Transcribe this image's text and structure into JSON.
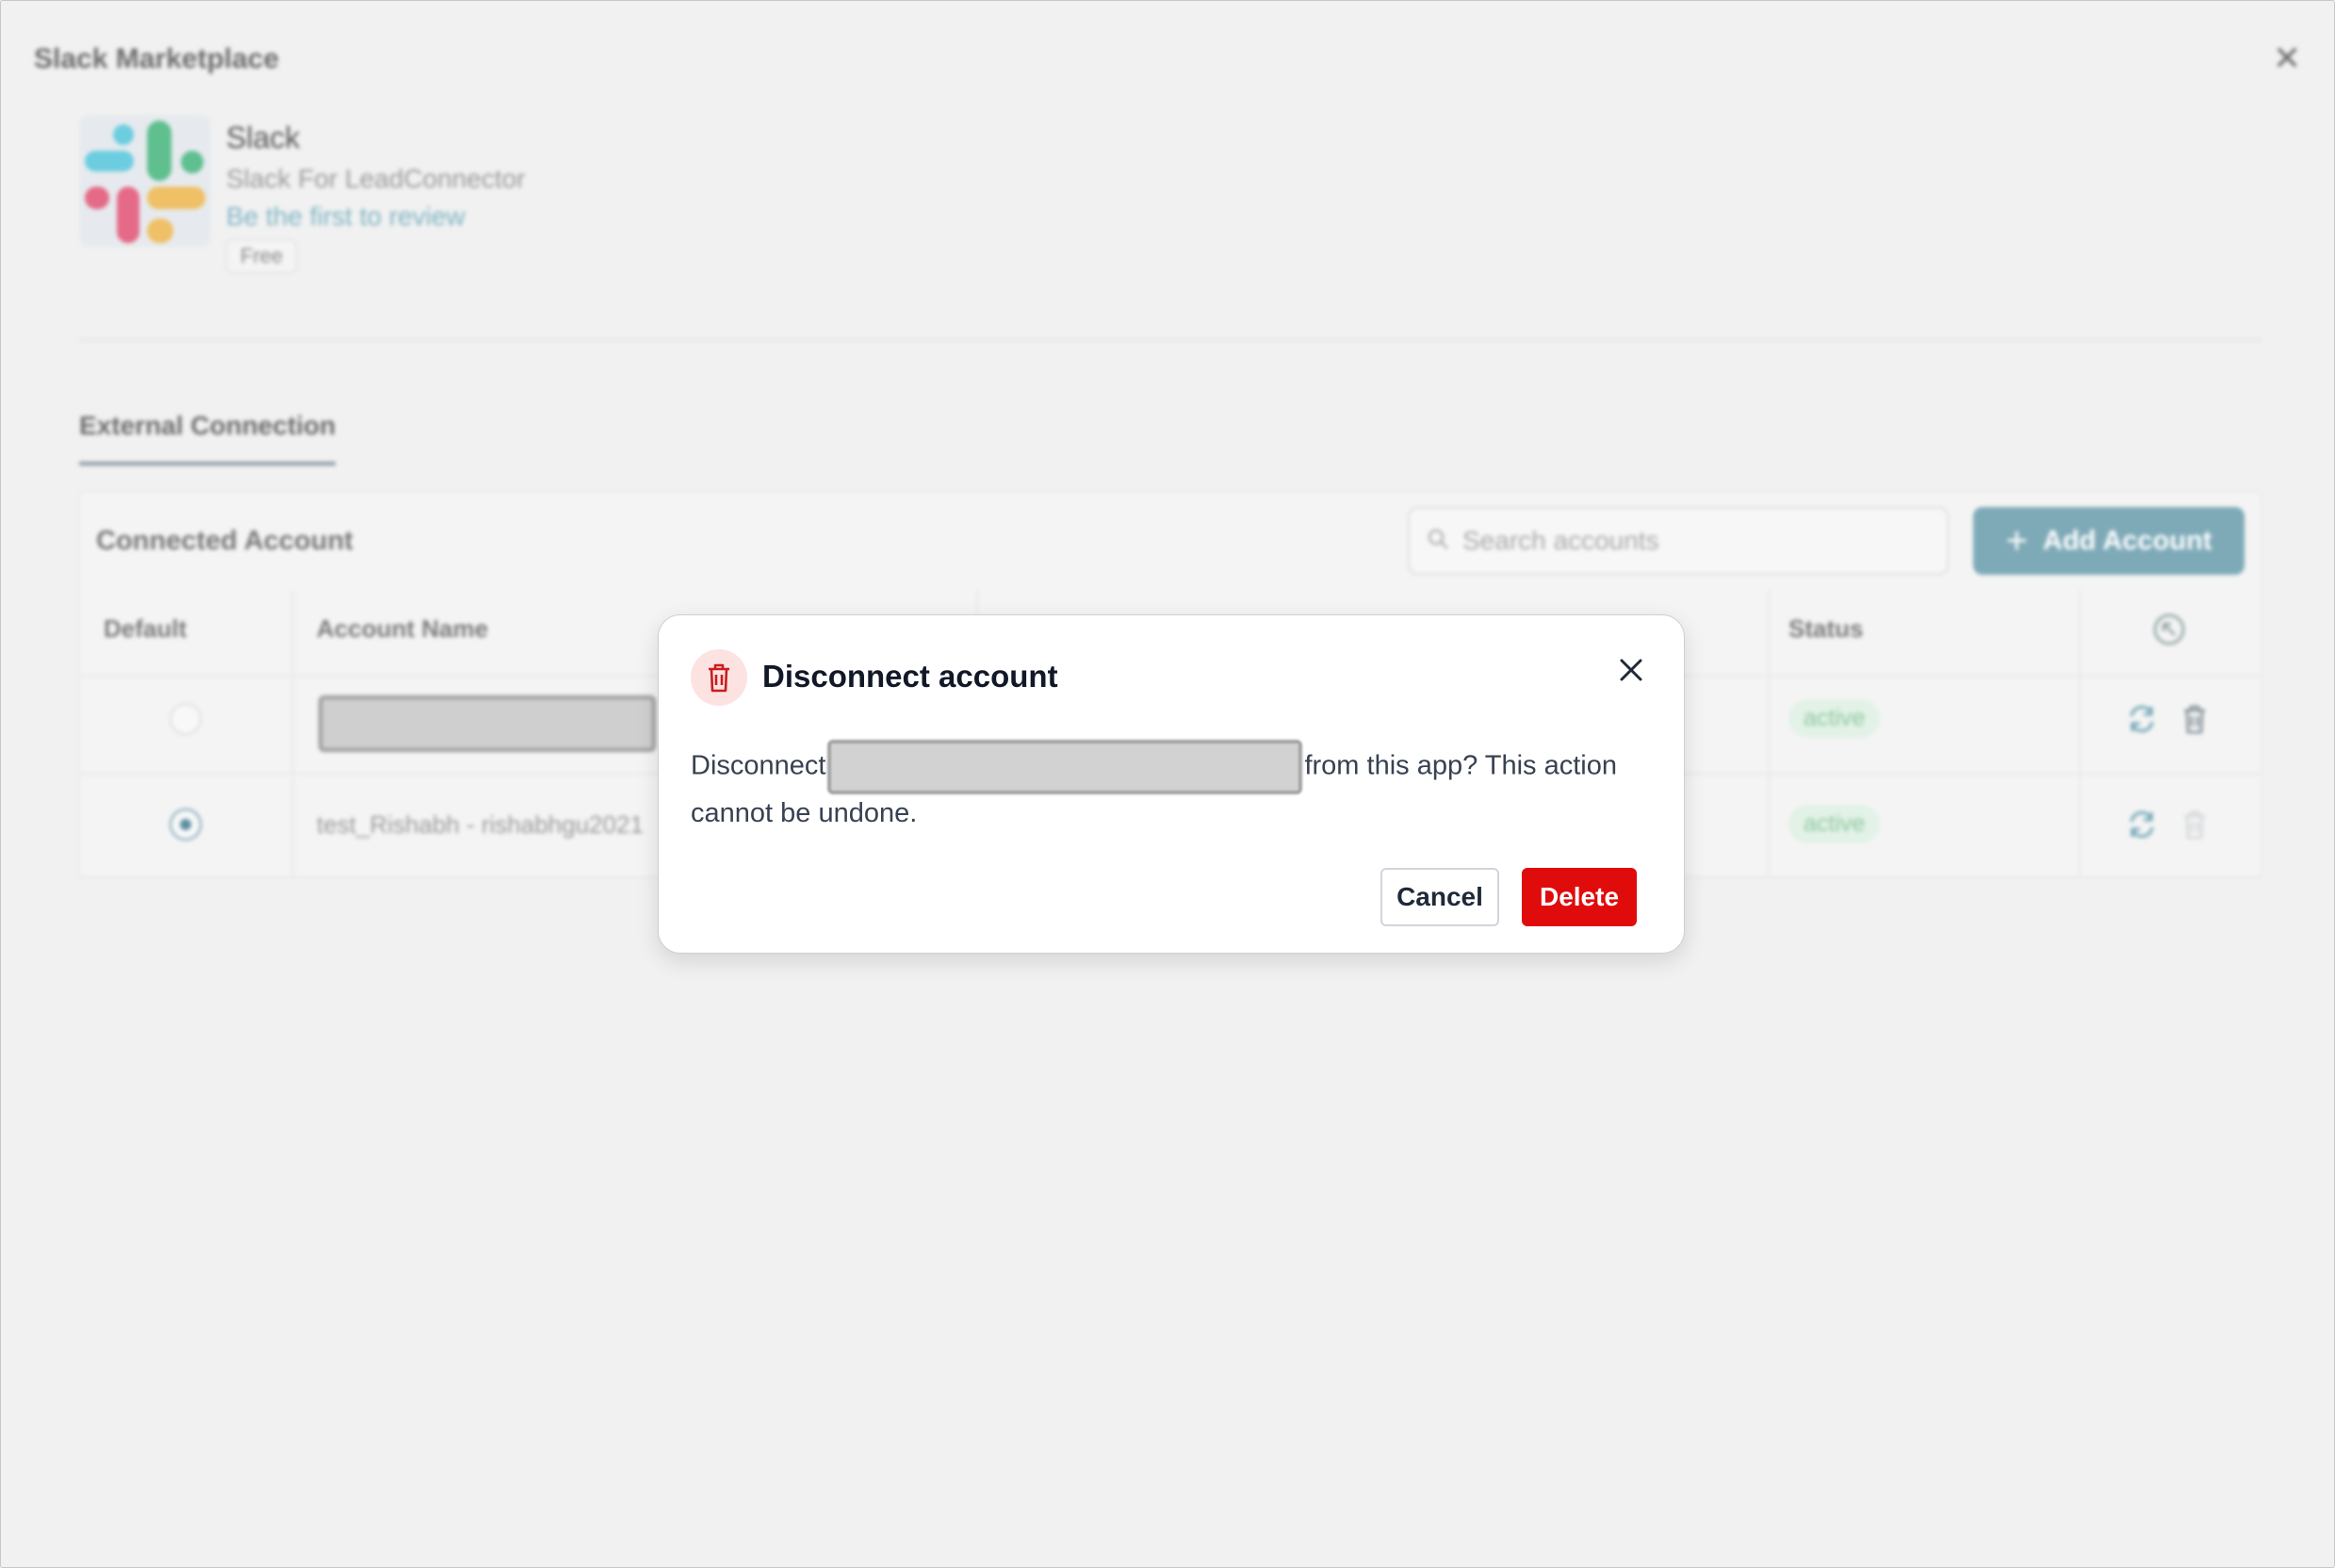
{
  "header": {
    "title": "Slack Marketplace"
  },
  "app": {
    "name": "Slack",
    "subtitle": "Slack For LeadConnector",
    "review_link": "Be the first to review",
    "price_badge": "Free"
  },
  "tabs": [
    {
      "label": "External Connection",
      "active": true
    }
  ],
  "panel": {
    "title": "Connected Account",
    "search_placeholder": "Search accounts",
    "add_button": "Add Account",
    "columns": {
      "default": "Default",
      "account_name": "Account Name",
      "status": "Status"
    },
    "rows": [
      {
        "default": false,
        "account_name": "",
        "status": "active"
      },
      {
        "default": true,
        "account_name": "test_Rishabh - rishabhgu2021",
        "status": "active"
      }
    ]
  },
  "dialog": {
    "title": "Disconnect account",
    "text_before": "Disconnect",
    "text_after": "from this app? This action cannot be undone.",
    "cancel_label": "Cancel",
    "delete_label": "Delete"
  },
  "colors": {
    "accent": "#7eaab8",
    "danger": "#e00c0c",
    "danger_soft": "#fde2e2",
    "active_status": "#8fc7a1"
  }
}
